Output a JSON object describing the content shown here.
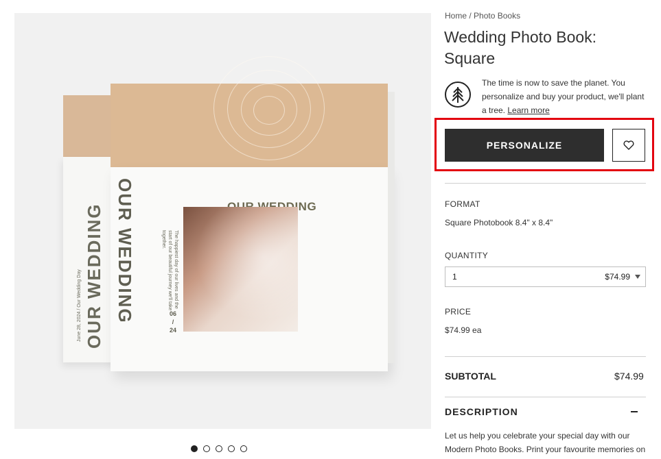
{
  "gallery": {
    "image_alt": "Wedding photo book product photo",
    "cover_title": "OUR WEDDING",
    "spine_title": "OUR WEDDING",
    "spine_subtitle": "June 28, 2024 / Our Wedding Day",
    "cover_caption": "The happiest day of our lives and the start of our beautiful journey we'll take together.",
    "cover_date_top": "06",
    "cover_date_sep": "/",
    "cover_date_bottom": "24",
    "slide_count": 5,
    "active_slide": 1
  },
  "breadcrumb": {
    "home": "Home",
    "separator": "/",
    "current": "Photo Books"
  },
  "product": {
    "title": "Wedding Photo Book: Square"
  },
  "eco": {
    "text": "The time is now to save the planet. You personalize and buy your product, we'll plant a tree.",
    "link": "Learn more",
    "icon": "tree-icon"
  },
  "actions": {
    "personalize_label": "PERSONALIZE",
    "wishlist_icon": "heart-icon"
  },
  "format": {
    "label": "FORMAT",
    "value": "Square Photobook 8.4\" x 8.4\""
  },
  "quantity": {
    "label": "QUANTITY",
    "selected": "1",
    "price": "$74.99"
  },
  "price": {
    "label": "PRICE",
    "value": "$74.99 ea"
  },
  "subtotal": {
    "label": "SUBTOTAL",
    "value": "$74.99"
  },
  "description": {
    "label": "DESCRIPTION",
    "body": "Let us help you celebrate your special day with our Modern Photo Books. Print your favourite memories on"
  },
  "colors": {
    "accent_highlight": "#e3000f",
    "button_dark": "#2e2e2e",
    "kraft": "#dcb994"
  }
}
